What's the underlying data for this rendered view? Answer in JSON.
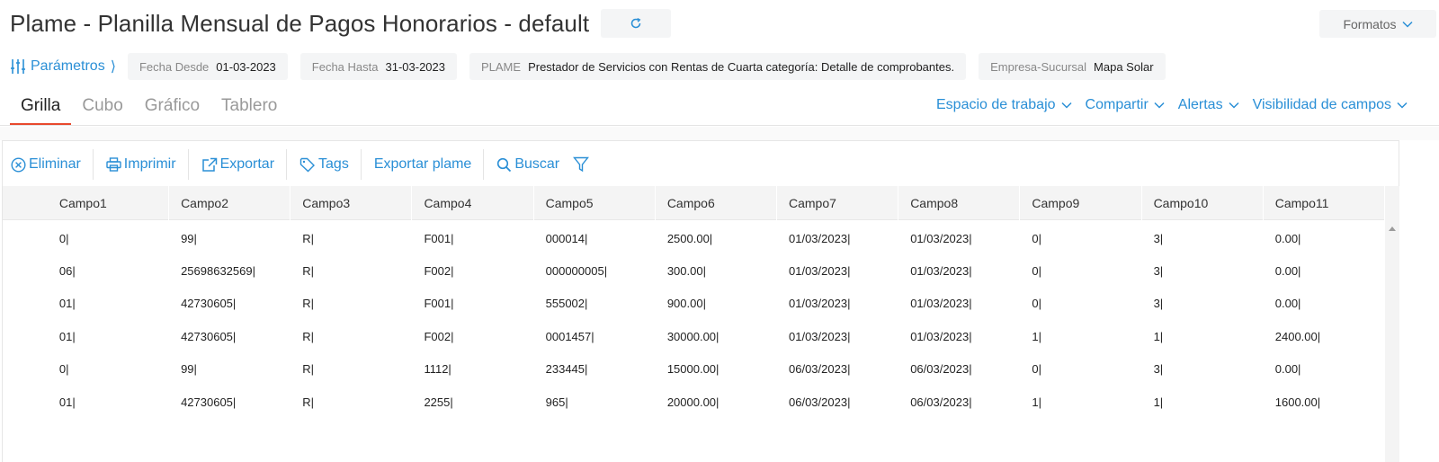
{
  "header": {
    "title": "Plame - Planilla Mensual de Pagos Honorarios - default",
    "formatos_label": "Formatos"
  },
  "params": {
    "link_label": "Parámetros",
    "chips": [
      {
        "key": "Fecha Desde",
        "value": "01-03-2023"
      },
      {
        "key": "Fecha Hasta",
        "value": "31-03-2023"
      },
      {
        "key": "PLAME",
        "value": "Prestador de Servicios con Rentas de Cuarta categoría: Detalle de comprobantes."
      },
      {
        "key": "Empresa-Sucursal",
        "value": "Mapa Solar"
      }
    ]
  },
  "tabs": [
    {
      "label": "Grilla",
      "active": true
    },
    {
      "label": "Cubo",
      "active": false
    },
    {
      "label": "Gráfico",
      "active": false
    },
    {
      "label": "Tablero",
      "active": false
    }
  ],
  "right_menus": [
    "Espacio de trabajo",
    "Compartir",
    "Alertas",
    "Visibilidad de campos"
  ],
  "toolbar": {
    "delete_label": "Eliminar",
    "print_label": "Imprimir",
    "export_label": "Exportar",
    "tags_label": "Tags",
    "export_plame_label": "Exportar plame",
    "search_label": "Buscar"
  },
  "grid": {
    "columns": [
      "Campo1",
      "Campo2",
      "Campo3",
      "Campo4",
      "Campo5",
      "Campo6",
      "Campo7",
      "Campo8",
      "Campo9",
      "Campo10",
      "Campo11"
    ],
    "rows": [
      [
        "0|",
        "99|",
        "R|",
        "F001|",
        "000014|",
        "2500.00|",
        "01/03/2023|",
        "01/03/2023|",
        "0|",
        "3|",
        "0.00|"
      ],
      [
        "06|",
        "25698632569|",
        "R|",
        "F002|",
        "000000005|",
        "300.00|",
        "01/03/2023|",
        "01/03/2023|",
        "0|",
        "3|",
        "0.00|"
      ],
      [
        "01|",
        "42730605|",
        "R|",
        "F001|",
        "555002|",
        "900.00|",
        "01/03/2023|",
        "01/03/2023|",
        "0|",
        "3|",
        "0.00|"
      ],
      [
        "01|",
        "42730605|",
        "R|",
        "F002|",
        "0001457|",
        "30000.00|",
        "01/03/2023|",
        "01/03/2023|",
        "1|",
        "1|",
        "2400.00|"
      ],
      [
        "0|",
        "99|",
        "R|",
        "1112|",
        "233445|",
        "15000.00|",
        "06/03/2023|",
        "06/03/2023|",
        "0|",
        "3|",
        "0.00|"
      ],
      [
        "01|",
        "42730605|",
        "R|",
        "2255|",
        "965|",
        "20000.00|",
        "06/03/2023|",
        "06/03/2023|",
        "1|",
        "1|",
        "1600.00|"
      ]
    ]
  },
  "colors": {
    "accent": "#2a8fd6",
    "active_tab_underline": "#e8492e"
  }
}
